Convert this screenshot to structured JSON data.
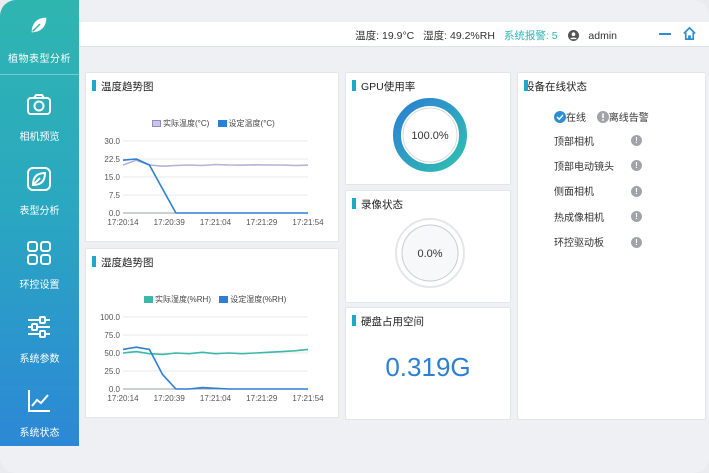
{
  "brand": {
    "title": "植物表型分析"
  },
  "sidebar": {
    "items": [
      {
        "label": "相机预览",
        "icon": "camera-icon"
      },
      {
        "label": "表型分析",
        "icon": "leaf-icon"
      },
      {
        "label": "环控设置",
        "icon": "grid-icon"
      },
      {
        "label": "系统参数",
        "icon": "sliders-icon"
      },
      {
        "label": "系统状态",
        "icon": "line-chart-icon"
      }
    ]
  },
  "header": {
    "temperature": "温度: 19.9°C",
    "humidity": "湿度: 49.2%RH",
    "alarm": "系统报警: 5",
    "user": "admin"
  },
  "temp_card": {
    "title": "温度趋势图",
    "legend_actual": "实际温度(°C)",
    "legend_set": "设定温度(°C)"
  },
  "humid_card": {
    "title": "湿度趋势图",
    "legend_actual": "实际湿度(%RH)",
    "legend_set": "设定湿度(%RH)"
  },
  "gpu_card": {
    "title": "GPU使用率",
    "value": "100.0%"
  },
  "rec_card": {
    "title": "录像状态",
    "value": "0.0%"
  },
  "disk_card": {
    "title": "硬盘占用空间",
    "value": "0.319G"
  },
  "devices": {
    "title": "设备在线状态",
    "legend_online": "在线",
    "legend_offline": "离线告警",
    "items": [
      "顶部相机",
      "顶部电动镜头",
      "侧面相机",
      "热成像相机",
      "环控驱动板"
    ]
  },
  "colors": {
    "accent": "#20a8c8",
    "actual": "#b5b2d6",
    "set": "#2c7fd4",
    "humid_actual": "#3cb8a8",
    "offline": "#a0a3a8"
  },
  "chart_data": [
    {
      "type": "line",
      "title": "温度趋势图",
      "categories": [
        "17:20:14",
        "17:20:39",
        "17:21:04",
        "17:21:29",
        "17:21:54"
      ],
      "ylim": [
        0,
        30
      ],
      "yticks": [
        "30.0",
        "22.5",
        "15.0",
        "7.5",
        "0.0"
      ],
      "series": [
        {
          "name": "实际温度(°C)",
          "values": [
            20,
            22,
            20,
            19.5,
            19.8,
            20,
            19.8,
            20.2,
            20,
            19.9,
            20.1,
            20,
            20,
            19.8,
            19.9
          ]
        },
        {
          "name": "设定温度(°C)",
          "values": [
            22,
            22.5,
            20,
            10,
            0,
            0,
            0,
            0,
            0,
            0,
            0,
            0,
            0,
            0,
            0
          ]
        }
      ]
    },
    {
      "type": "line",
      "title": "湿度趋势图",
      "categories": [
        "17:20:14",
        "17:20:39",
        "17:21:04",
        "17:21:29",
        "17:21:54"
      ],
      "ylim": [
        0,
        100
      ],
      "yticks": [
        "100.0",
        "75.0",
        "50.0",
        "25.0",
        "0.0"
      ],
      "series": [
        {
          "name": "实际湿度(%RH)",
          "values": [
            50,
            52,
            49,
            48,
            50,
            49,
            51,
            49,
            50,
            49,
            50,
            51,
            52,
            53,
            55
          ]
        },
        {
          "name": "设定湿度(%RH)",
          "values": [
            55,
            58,
            55,
            20,
            0,
            0,
            2,
            1,
            0,
            0,
            0,
            0,
            0,
            0,
            0
          ]
        }
      ]
    }
  ]
}
